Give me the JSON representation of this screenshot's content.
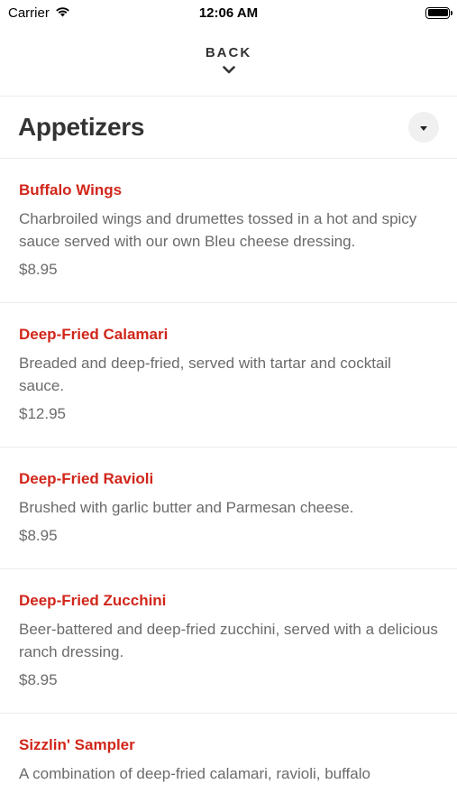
{
  "status_bar": {
    "carrier": "Carrier",
    "time": "12:06 AM",
    "wifi_icon": "wifi-icon",
    "battery_icon": "battery-icon"
  },
  "nav": {
    "back_label": "BACK",
    "back_icon": "chevron-down-icon"
  },
  "section": {
    "title": "Appetizers",
    "toggle_icon": "caret-down-icon"
  },
  "colors": {
    "item_name": "#d1261a",
    "item_text": "#6b6b6b",
    "title": "#333333",
    "divider": "#ececec"
  },
  "menu_items": [
    {
      "name": "Buffalo Wings",
      "description": "Charbroiled wings and drumettes tossed in a hot and spicy sauce served with our own Bleu cheese dressing.",
      "price": "$8.95"
    },
    {
      "name": "Deep-Fried Calamari",
      "description": "Breaded and deep-fried, served with tartar and cocktail sauce.",
      "price": "$12.95"
    },
    {
      "name": "Deep-Fried Ravioli",
      "description": "Brushed with garlic butter and Parmesan cheese.",
      "price": "$8.95"
    },
    {
      "name": "Deep-Fried Zucchini",
      "description": "Beer-battered and deep-fried zucchini, served with a delicious ranch dressing.",
      "price": "$8.95"
    },
    {
      "name": "Sizzlin' Sampler",
      "description": "A combination of deep-fried calamari, ravioli, buffalo",
      "price": ""
    }
  ]
}
